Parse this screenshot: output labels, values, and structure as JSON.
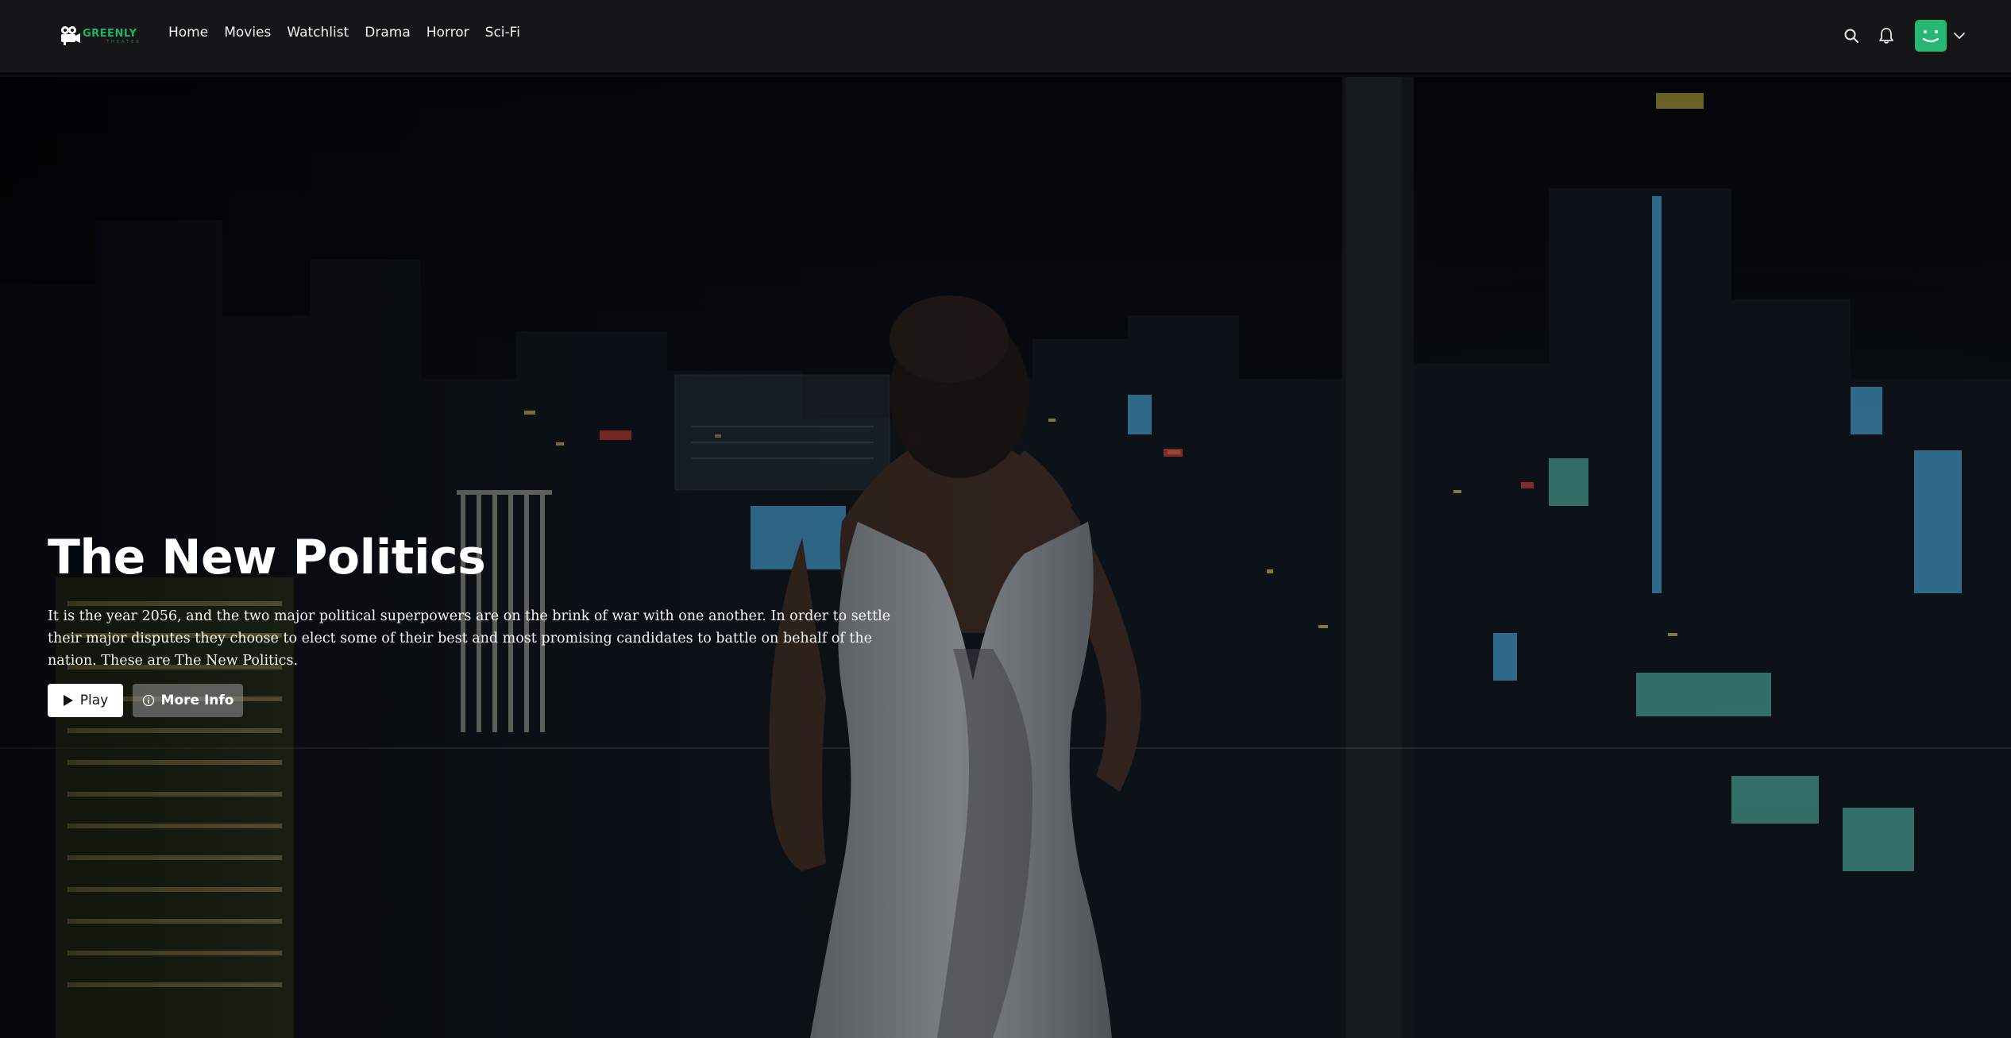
{
  "app": {
    "brand_name": "GREENLY",
    "brand_sub": "THEATER",
    "accent_color": "#25b873"
  },
  "nav": {
    "items": [
      {
        "label": "Home"
      },
      {
        "label": "Movies"
      },
      {
        "label": "Watchlist"
      },
      {
        "label": "Drama"
      },
      {
        "label": "Horror"
      },
      {
        "label": "Sci-Fi"
      }
    ]
  },
  "header_icons": {
    "search": "search-icon",
    "notifications": "bell-icon",
    "profile": "avatar",
    "profile_menu": "chevron-down-icon"
  },
  "hero": {
    "title": "The New Politics",
    "description": "It is the year 2056, and the two major political superpowers are on the brink of war with one another. In order to settle their major disputes they choose to elect some of their best and most promising candidates to battle on behalf of the nation. These are The New Politics.",
    "play_label": "Play",
    "play_icon": "play-icon",
    "info_label": "More Info",
    "info_icon": "info-icon"
  }
}
